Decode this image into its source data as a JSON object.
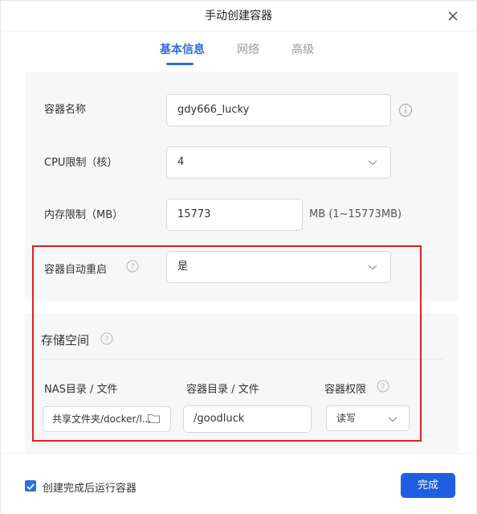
{
  "dialog": {
    "title": "手动创建容器"
  },
  "tabs": [
    {
      "label": "基本信息",
      "active": true
    },
    {
      "label": "网络",
      "active": false
    },
    {
      "label": "高级",
      "active": false
    }
  ],
  "form": {
    "container_name": {
      "label": "容器名称",
      "value": "gdy666_lucky"
    },
    "cpu_limit": {
      "label": "CPU限制（核）",
      "value": "4"
    },
    "memory_limit": {
      "label": "内存限制（MB）",
      "value": "15773",
      "unit": "MB (1~15773MB)"
    },
    "auto_restart": {
      "label": "容器自动重启",
      "value": "是"
    }
  },
  "storage": {
    "title": "存储空间",
    "columns": {
      "nas": "NAS目录 / 文件",
      "container": "容器目录 / 文件",
      "permission": "容器权限"
    },
    "row": {
      "nas_path": "共享文件夹/docker/l...",
      "container_path": "/goodluck",
      "permission": "读写"
    }
  },
  "footer": {
    "run_after_create_label": "创建完成后运行容器",
    "run_after_create_checked": true,
    "done_label": "完成"
  },
  "colors": {
    "accent": "#2f6fd8",
    "primary_button": "#1d5fe0",
    "highlight_box": "#e02020"
  }
}
